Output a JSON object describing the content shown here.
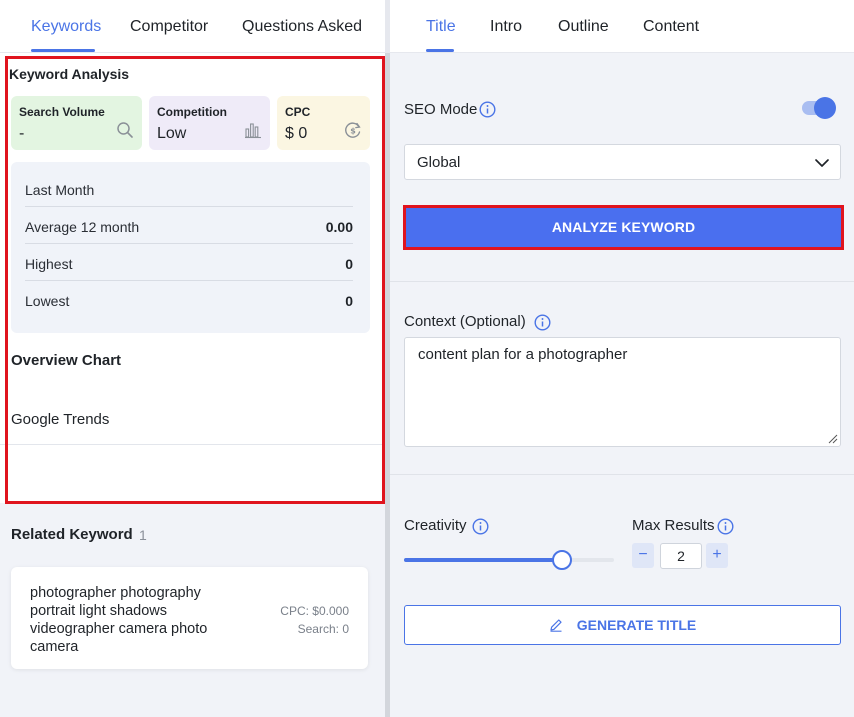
{
  "left_tabs": [
    "Keywords",
    "Competitor",
    "Questions Asked"
  ],
  "right_tabs": [
    "Title",
    "Intro",
    "Outline",
    "Content"
  ],
  "keyword_analysis": {
    "title": "Keyword Analysis",
    "metrics": [
      {
        "label": "Search Volume",
        "value": "-",
        "icon": "search-icon",
        "bg": "#e3f5e1"
      },
      {
        "label": "Competition",
        "value": "Low",
        "icon": "bar-chart-icon",
        "bg": "#efebf8"
      },
      {
        "label": "CPC",
        "value": "$ 0",
        "icon": "dollar-cycle-icon",
        "bg": "#fbf6e2"
      }
    ],
    "stats": [
      {
        "label": "Last Month",
        "value": ""
      },
      {
        "label": "Average 12 month",
        "value": "0.00"
      },
      {
        "label": "Highest",
        "value": "0"
      },
      {
        "label": "Lowest",
        "value": "0"
      }
    ],
    "overview_title": "Overview Chart",
    "google_trends_label": "Google Trends"
  },
  "related": {
    "title": "Related Keyword",
    "count": "1",
    "item": {
      "keyword": "photographer photography portrait light shadows videographer camera photo camera",
      "cpc": "CPC: $0.000",
      "search": "Search: 0"
    }
  },
  "form": {
    "seo_mode_label": "SEO Mode",
    "seo_mode_on": true,
    "region_value": "Global",
    "analyze_label": "ANALYZE KEYWORD",
    "context_label": "Context (Optional)",
    "context_value": "content plan for a photographer",
    "creativity_label": "Creativity",
    "creativity_level": 0.75,
    "max_results_label": "Max Results",
    "max_results_value": "2",
    "minus": "−",
    "plus": "+",
    "generate_label": "GENERATE TITLE"
  },
  "colors": {
    "accent": "#4a74e6",
    "button": "#4a6fef",
    "highlight": "#e0141e"
  }
}
